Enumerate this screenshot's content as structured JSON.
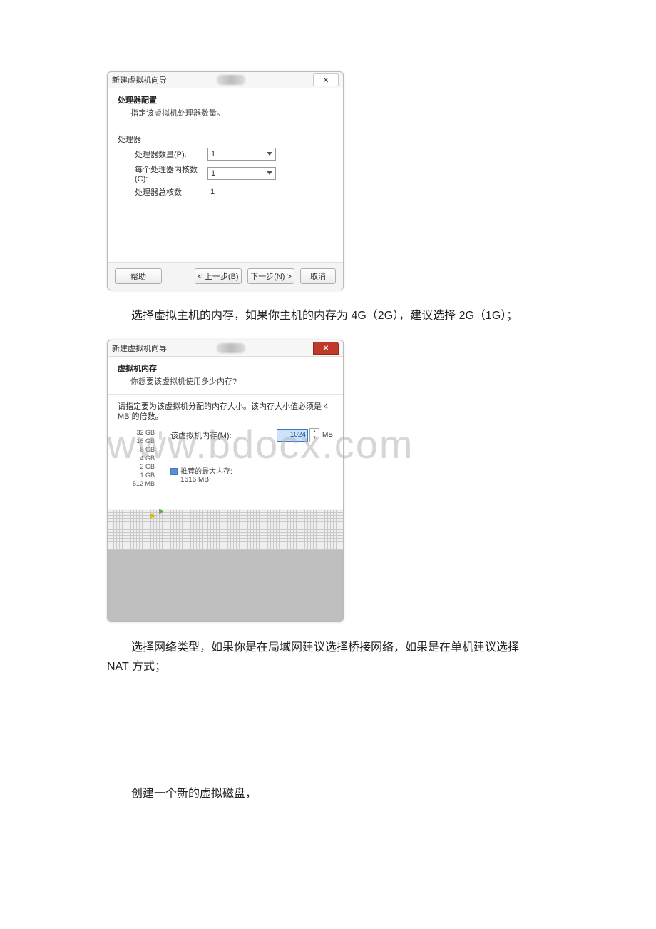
{
  "dialog1": {
    "window_title": "新建虚拟机向导",
    "close_glyph": "✕",
    "header_title": "处理器配置",
    "header_sub": "指定该虚拟机处理器数量。",
    "group_label": "处理器",
    "rows": {
      "count_label": "处理器数量(P):",
      "count_value": "1",
      "cores_label": "每个处理器内核数(C):",
      "cores_value": "1",
      "total_label": "处理器总核数:",
      "total_value": "1"
    },
    "buttons": {
      "help": "帮助",
      "back": "< 上一步(B)",
      "next": "下一步(N) >",
      "cancel": "取消"
    }
  },
  "para1": "选择虚拟主机的内存，如果你主机的内存为 4G（2G），建议选择 2G（1G）；",
  "dialog2": {
    "window_title": "新建虚拟机向导",
    "close_glyph": "✕",
    "header_title": "虚拟机内存",
    "header_sub": "你想要该虚拟机使用多少内存?",
    "note": "请指定要为该虚拟机分配的内存大小。该内存大小值必须是 4 MB 的倍数。",
    "mem_label": "该虚拟机内存(M):",
    "mem_value": "1024",
    "mem_unit": "MB",
    "rec_label": "推荐的最大内存:",
    "rec_value": "1616 MB",
    "scale": [
      "32 GB",
      "16 GB",
      "8 GB",
      "4 GB",
      "2 GB",
      "1 GB",
      "512 MB"
    ]
  },
  "para2_a": "选择网络类型，如果你是在局域网建议选择桥接网络，如果是在单机建议选择",
  "para2_b": "NAT 方式；",
  "para3": "创建一个新的虚拟磁盘，",
  "watermark": "www.bdocx.com"
}
